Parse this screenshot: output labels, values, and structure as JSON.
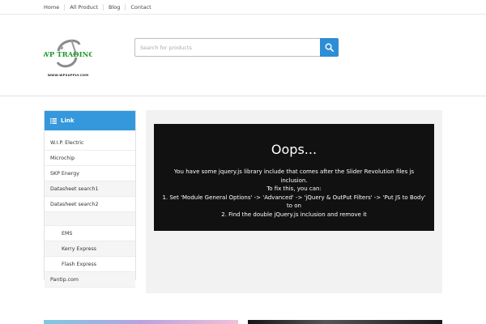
{
  "topnav": {
    "items": [
      "Home",
      "All Product",
      "Blog",
      "Contact"
    ]
  },
  "logo": {
    "brand": "WP TRADING",
    "tagline": "WWW.WPSUPPLY.COM"
  },
  "search": {
    "placeholder": "Search for products",
    "button_icon": "search-icon"
  },
  "sidebar": {
    "heading": "Link",
    "heading_icon": "list-icon",
    "items": [
      "W.I.P. Electric",
      "Microchip",
      "SKP Energy",
      "Datasheet search1",
      "Datasheet search2",
      "EMS",
      "Kerry Express",
      "Flash Express",
      "Pantip.com"
    ]
  },
  "slider_error": {
    "title": "Oops...",
    "lines": [
      "You have some jquery.js library include that comes after the Slider Revolution files js inclusion.",
      "To fix this, you can:",
      "1. Set 'Module General Options' -> 'Advanced' -> 'jQuery & OutPut Filters' -> 'Put JS to Body' to on",
      "2. Find the double jQuery.js inclusion and remove it"
    ]
  },
  "colors": {
    "accent": "#3598dc",
    "search_button": "#2d8dd6",
    "error_bg": "#111111"
  }
}
